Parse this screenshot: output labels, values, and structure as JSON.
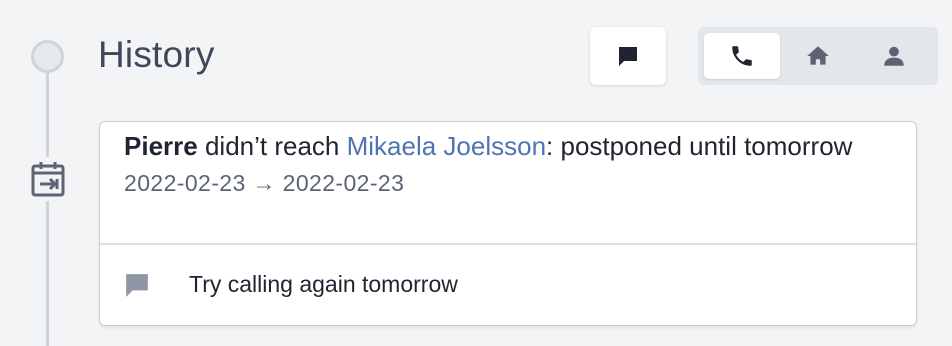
{
  "history": {
    "title": "History"
  },
  "filters": {
    "comment_icon": "comment-icon",
    "buttons": [
      {
        "icon": "phone-icon",
        "active": true
      },
      {
        "icon": "home-icon",
        "active": false
      },
      {
        "icon": "person-icon",
        "active": false
      }
    ]
  },
  "event": {
    "icon": "calendar-postpone-icon",
    "actor": "Pierre",
    "action_text": " didn’t reach ",
    "contact": "Mikaela Joelsson",
    "outcome_text": ": postponed until tomorrow",
    "date_range": "2022-02-23 → 2022-02-23",
    "note_icon": "comment-icon",
    "note": "Try calling again tomorrow"
  },
  "colors": {
    "background": "#f3f4f6",
    "link": "#4f74b3",
    "icon": "#5c6474",
    "note_icon": "#8f97a6"
  }
}
